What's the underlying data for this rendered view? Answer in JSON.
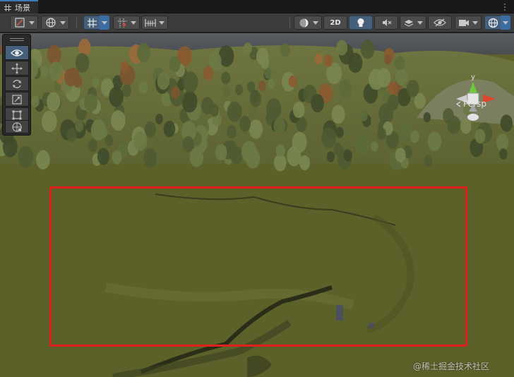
{
  "tab": {
    "label": "场景",
    "icon": "grid-icon"
  },
  "toolbar": {
    "two_d_label": "2D",
    "icons": [
      "draw-mode-icon",
      "globe-icon",
      "grid-snap-icon",
      "increment-snap-icon",
      "ruler-icon",
      "shading-icon",
      "light-icon",
      "audio-icon",
      "effects-icon",
      "visibility-icon",
      "camera-icon",
      "gizmos-icon"
    ]
  },
  "gizmo": {
    "y_label": "y",
    "persp_label": "Persp"
  },
  "tools": [
    "view-tool-icon",
    "move-tool-icon",
    "rotate-tool-icon",
    "scale-tool-icon",
    "rect-tool-icon",
    "transform-tool-icon"
  ],
  "watermark": "@稀土掘金技术社区",
  "colors": {
    "accent": "#46607c",
    "highlight": "#e0201c",
    "ground": "#5c6029"
  }
}
